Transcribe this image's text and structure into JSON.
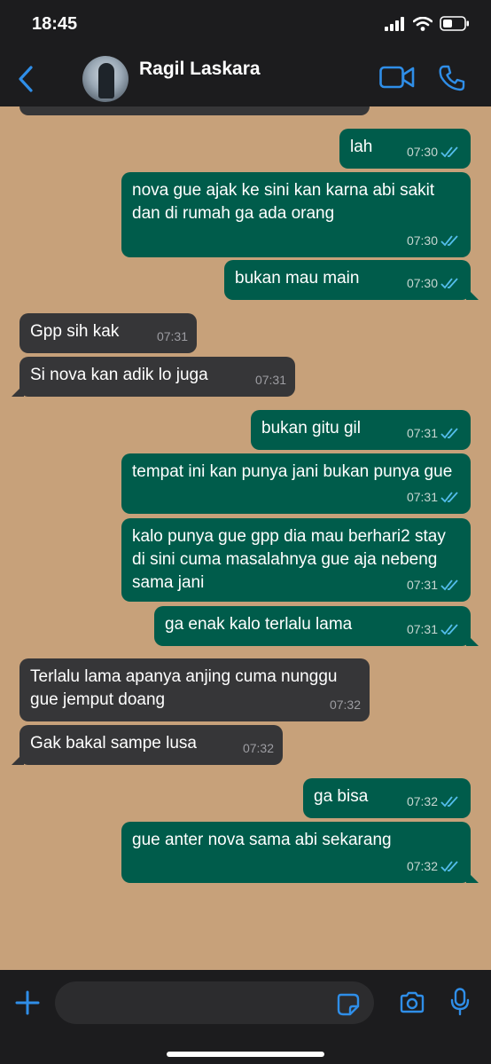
{
  "status_bar": {
    "time": "18:45"
  },
  "header": {
    "contact_name": "Ragil Laskara"
  },
  "messages": [
    {
      "dir": "out",
      "text": "lah",
      "time": "07:30"
    },
    {
      "dir": "out",
      "text": "nova gue ajak ke sini kan karna abi sakit dan di rumah ga ada orang",
      "time": "07:30"
    },
    {
      "dir": "out",
      "text": "bukan mau main",
      "time": "07:30"
    },
    {
      "dir": "in",
      "text": "Gpp sih kak",
      "time": "07:31"
    },
    {
      "dir": "in",
      "text": "Si nova kan adik lo juga",
      "time": "07:31"
    },
    {
      "dir": "out",
      "text": "bukan gitu gil",
      "time": "07:31"
    },
    {
      "dir": "out",
      "text": "tempat ini kan punya jani bukan punya gue",
      "time": "07:31"
    },
    {
      "dir": "out",
      "text": "kalo punya gue gpp dia mau berhari2 stay di sini cuma masalahnya gue aja nebeng sama jani",
      "time": "07:31"
    },
    {
      "dir": "out",
      "text": "ga enak kalo terlalu lama",
      "time": "07:31"
    },
    {
      "dir": "in",
      "text": "Terlalu lama apanya anjing cuma nunggu gue jemput doang",
      "time": "07:32"
    },
    {
      "dir": "in",
      "text": "Gak bakal sampe lusa",
      "time": "07:32"
    },
    {
      "dir": "out",
      "text": "ga bisa",
      "time": "07:32"
    },
    {
      "dir": "out",
      "text": "gue anter nova sama abi sekarang",
      "time": "07:32"
    }
  ],
  "composer": {
    "placeholder": ""
  },
  "icons": {
    "back": "chevron-left-icon",
    "video": "video-camera-icon",
    "call": "phone-icon",
    "attach": "plus-icon",
    "sticker": "sticker-icon",
    "camera": "camera-icon",
    "mic": "microphone-icon",
    "read": "double-check-icon"
  },
  "colors": {
    "accent": "#2f8ee8",
    "outgoing_bubble": "#005c4b",
    "incoming_bubble": "#363638",
    "wallpaper": "#c7a17a",
    "read_tick": "#53bdeb"
  }
}
